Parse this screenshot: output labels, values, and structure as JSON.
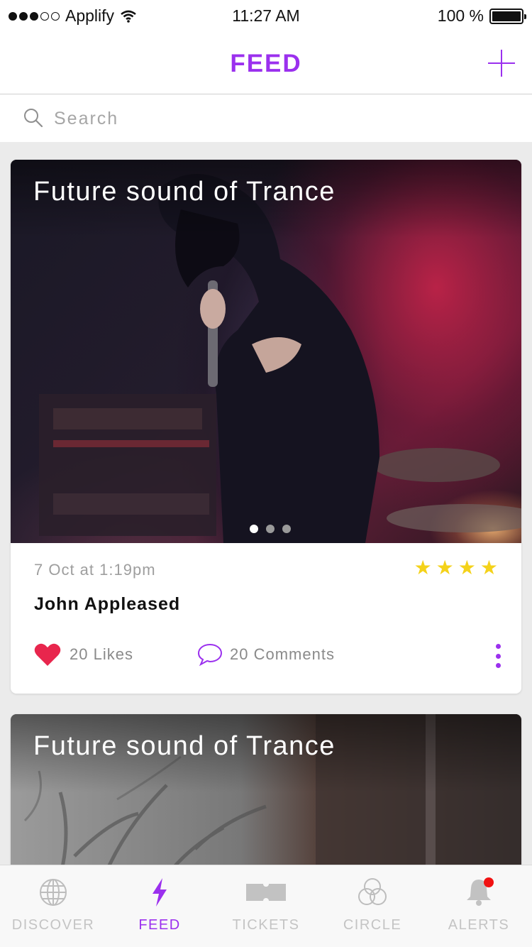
{
  "status_bar": {
    "carrier": "Applify",
    "time": "11:27 AM",
    "battery": "100 %",
    "battery_level": 1.0,
    "signal_bars": 3
  },
  "header": {
    "title": "FEED",
    "add_icon": "plus-icon"
  },
  "search": {
    "placeholder": "Search",
    "icon": "search-icon"
  },
  "posts": [
    {
      "title": "Future sound of Trance",
      "date": "7 Oct at 1:19pm",
      "author": "John Appleased",
      "rating": 4,
      "likes": "20 Likes",
      "comments": "20 Comments",
      "pager": {
        "count": 3,
        "active": 0
      }
    },
    {
      "title": "Future sound of Trance"
    }
  ],
  "tabs": [
    {
      "label": "DISCOVER",
      "icon": "globe-icon",
      "active": false
    },
    {
      "label": "FEED",
      "icon": "lightning-icon",
      "active": true
    },
    {
      "label": "TICKETS",
      "icon": "ticket-icon",
      "active": false
    },
    {
      "label": "CIRCLE",
      "icon": "circles-icon",
      "active": false
    },
    {
      "label": "ALERTS",
      "icon": "bell-icon",
      "active": false,
      "badge": true
    }
  ],
  "colors": {
    "accent": "#9b30ee",
    "star": "#f4d21a",
    "heart": "#e8264d",
    "badge": "#f11212",
    "inactive": "#c4c4c4"
  }
}
